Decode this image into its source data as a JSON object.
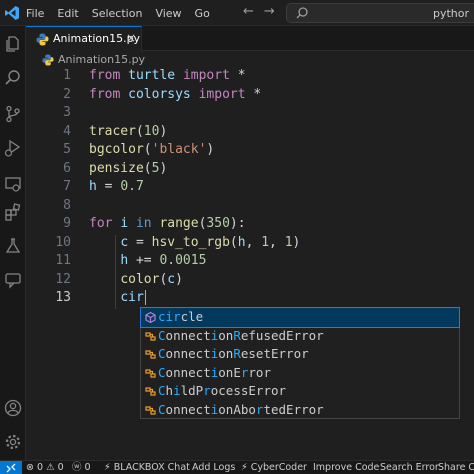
{
  "menu": [
    "File",
    "Edit",
    "Selection",
    "View",
    "Go"
  ],
  "command_center": {
    "text": "pythor"
  },
  "tab": {
    "label": "Animation15.py"
  },
  "breadcrumb": {
    "file": "Animation15.py"
  },
  "editor": {
    "lines": [
      {
        "n": "1",
        "tokens": [
          [
            "kw",
            "from "
          ],
          [
            "var",
            "turtle "
          ],
          [
            "kw",
            "import "
          ],
          [
            "op",
            "*"
          ]
        ]
      },
      {
        "n": "2",
        "tokens": [
          [
            "kw",
            "from "
          ],
          [
            "var",
            "colorsys "
          ],
          [
            "kw",
            "import "
          ],
          [
            "op",
            "*"
          ]
        ]
      },
      {
        "n": "3",
        "tokens": []
      },
      {
        "n": "4",
        "tokens": [
          [
            "fn",
            "tracer"
          ],
          [
            "op",
            "("
          ],
          [
            "num",
            "10"
          ],
          [
            "op",
            ")"
          ]
        ]
      },
      {
        "n": "5",
        "tokens": [
          [
            "fn",
            "bgcolor"
          ],
          [
            "op",
            "("
          ],
          [
            "str",
            "'black'"
          ],
          [
            "op",
            ")"
          ]
        ]
      },
      {
        "n": "6",
        "tokens": [
          [
            "fn",
            "pensize"
          ],
          [
            "op",
            "("
          ],
          [
            "num",
            "5"
          ],
          [
            "op",
            ")"
          ]
        ]
      },
      {
        "n": "7",
        "tokens": [
          [
            "var",
            "h"
          ],
          [
            "op",
            " = "
          ],
          [
            "num",
            "0.7"
          ]
        ]
      },
      {
        "n": "8",
        "tokens": []
      },
      {
        "n": "9",
        "tokens": [
          [
            "kw",
            "for "
          ],
          [
            "var",
            "i "
          ],
          [
            "ctl",
            "in "
          ],
          [
            "fn",
            "range"
          ],
          [
            "op",
            "("
          ],
          [
            "num",
            "350"
          ],
          [
            "op",
            "):"
          ]
        ]
      },
      {
        "n": "10",
        "tokens": [
          [
            "op",
            "    "
          ],
          [
            "var",
            "c"
          ],
          [
            "op",
            " = "
          ],
          [
            "fn",
            "hsv_to_rgb"
          ],
          [
            "op",
            "("
          ],
          [
            "var",
            "h"
          ],
          [
            "op",
            ", "
          ],
          [
            "num",
            "1"
          ],
          [
            "op",
            ", "
          ],
          [
            "num",
            "1"
          ],
          [
            "op",
            ")"
          ]
        ]
      },
      {
        "n": "11",
        "tokens": [
          [
            "op",
            "    "
          ],
          [
            "var",
            "h"
          ],
          [
            "op",
            " += "
          ],
          [
            "num",
            "0.0015"
          ]
        ]
      },
      {
        "n": "12",
        "tokens": [
          [
            "op",
            "    "
          ],
          [
            "fn",
            "color"
          ],
          [
            "op",
            "("
          ],
          [
            "var",
            "c"
          ],
          [
            "op",
            ")"
          ]
        ]
      },
      {
        "n": "13",
        "tokens": [
          [
            "op",
            "    "
          ],
          [
            "var",
            "cir"
          ]
        ]
      }
    ],
    "active_line": "13"
  },
  "suggestions": [
    {
      "match": "cir",
      "rest": "cle",
      "full": "circle",
      "kind": "function",
      "selected": true
    },
    {
      "full": "ConnectionRefusedError",
      "kind": "class",
      "selected": false
    },
    {
      "full": "ConnectionResetError",
      "kind": "class",
      "selected": false
    },
    {
      "full": "ConnectionError",
      "kind": "class",
      "selected": false
    },
    {
      "full": "ChildProcessError",
      "kind": "class",
      "selected": false
    },
    {
      "full": "ConnectionAbortedError",
      "kind": "class",
      "selected": false
    }
  ],
  "status": {
    "errors": "0",
    "warnings": "0",
    "info": "0",
    "items": [
      "BLACKBOX Chat",
      "Add Logs",
      "CyberCoder",
      "Improve Code",
      "Search Error",
      "Share C"
    ]
  },
  "colors": {
    "accent": "#0078d4",
    "selection": "#04395e",
    "match": "#2aaaff"
  }
}
